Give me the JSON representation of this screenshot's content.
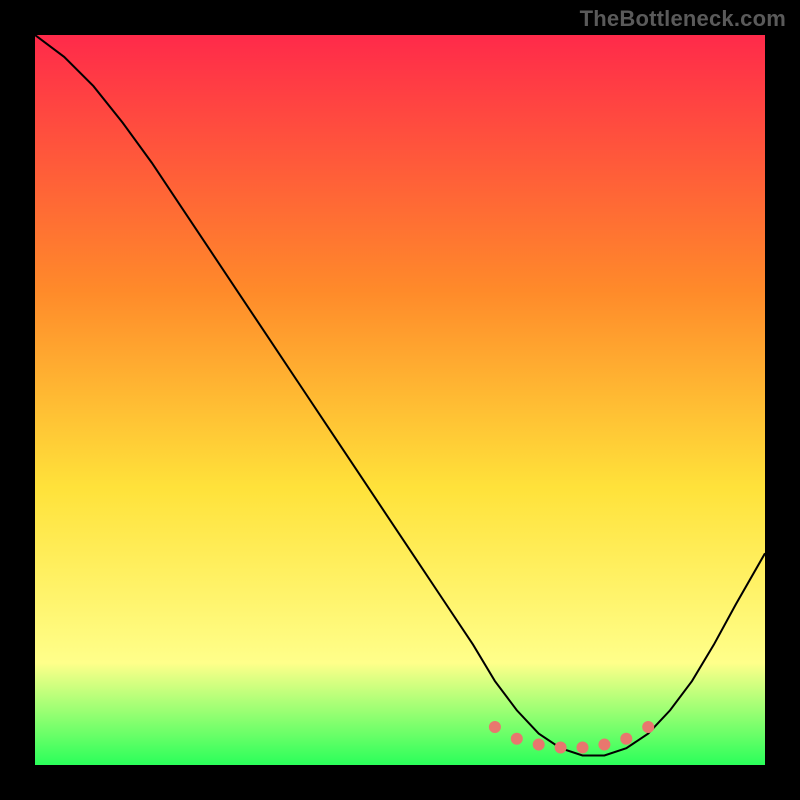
{
  "watermark": "TheBottleneck.com",
  "colors": {
    "frame": "#000000",
    "gradient_top": "#ff2a4a",
    "gradient_mid1": "#ff8a2a",
    "gradient_mid2": "#ffe23a",
    "gradient_mid3": "#ffff8a",
    "gradient_bottom": "#2aff5a",
    "curve": "#000000",
    "dots": "#e8776e"
  },
  "chart_data": {
    "type": "line",
    "title": "",
    "xlabel": "",
    "ylabel": "",
    "xlim": [
      0,
      100
    ],
    "ylim": [
      0,
      100
    ],
    "grid": false,
    "legend": false,
    "series": [
      {
        "name": "bottleneck-curve",
        "x": [
          0,
          4,
          8,
          12,
          16,
          20,
          24,
          28,
          32,
          36,
          40,
          44,
          48,
          52,
          56,
          60,
          63,
          66,
          69,
          72,
          75,
          78,
          81,
          84,
          87,
          90,
          93,
          96,
          100
        ],
        "y": [
          100,
          97,
          93,
          88,
          82.5,
          76.5,
          70.5,
          64.5,
          58.5,
          52.5,
          46.5,
          40.5,
          34.5,
          28.5,
          22.5,
          16.5,
          11.5,
          7.5,
          4.3,
          2.3,
          1.3,
          1.3,
          2.3,
          4.3,
          7.5,
          11.5,
          16.5,
          22.0,
          29.0
        ]
      }
    ],
    "markers": {
      "name": "optimal-range-dots",
      "x": [
        63,
        66,
        69,
        72,
        75,
        78,
        81,
        84
      ],
      "y": [
        5.2,
        3.6,
        2.8,
        2.4,
        2.4,
        2.8,
        3.6,
        5.2
      ]
    }
  }
}
